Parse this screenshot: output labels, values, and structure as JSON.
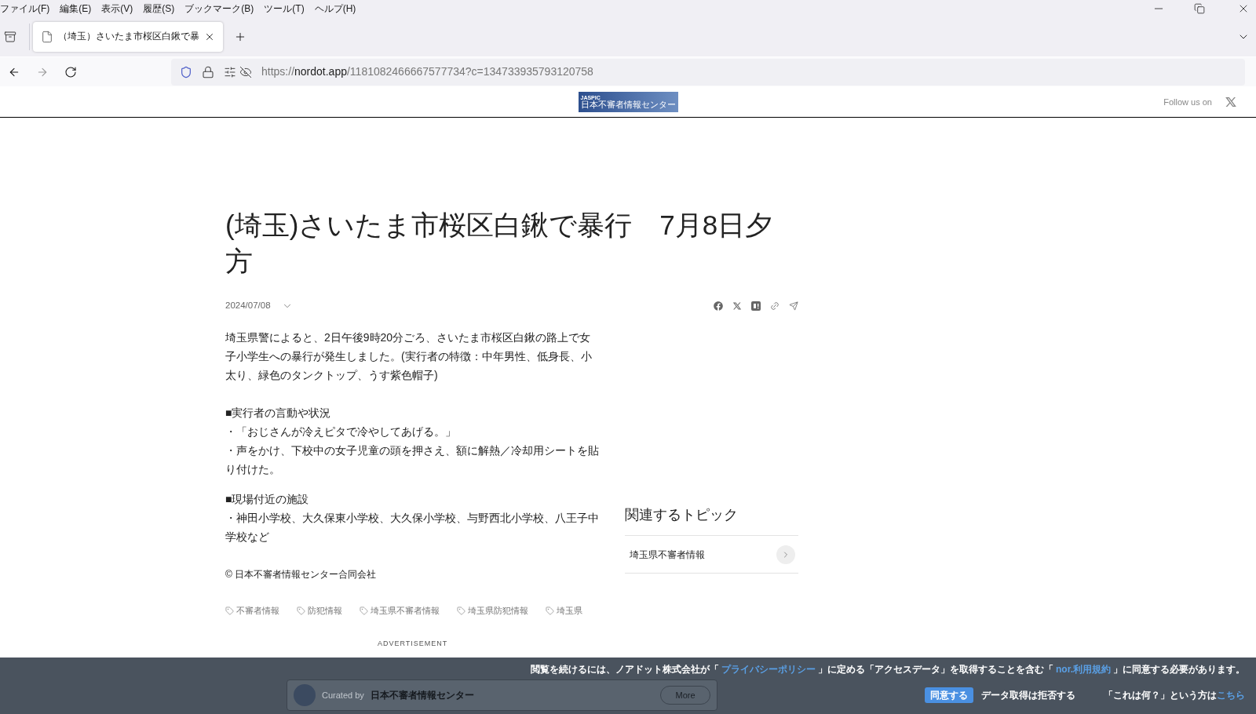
{
  "menu_bar": [
    "ファイル(F)",
    "編集(E)",
    "表示(V)",
    "履歴(S)",
    "ブックマーク(B)",
    "ツール(T)",
    "ヘルプ(H)"
  ],
  "tabs": [
    {
      "title": "（埼玉）さいたま市桜区白鍬で暴",
      "selected": true
    }
  ],
  "address_bar": {
    "url_scheme": "https://",
    "url_host": "nordot.app",
    "url_path": "/1181082466667577734?c=134733935793120758"
  },
  "site_header": {
    "logo_small": "JASPIC",
    "logo_text": "日本不審者情報センター",
    "follow_label": "Follow us on"
  },
  "article": {
    "title": "(埼玉)さいたま市桜区白鍬で暴行　7月8日夕方",
    "date": "2024/07/08",
    "blocks": [
      [
        "埼玉県警によると、2日午後9時20分ごろ、さいたま市桜区白鍬の路上で女子小学生への暴行が発生しました。(実行者の特徴：中年男性、低身長、小太り、緑色のタンクトップ、うす紫色帽子)"
      ],
      [
        "■実行者の言動や状況",
        "・「おじさんが冷えピタで冷やしてあげる。」",
        "・声をかけ、下校中の女子児童の頭を押さえ、額に解熱／冷却用シートを貼り付けた。"
      ],
      [
        "■現場付近の施設",
        "・神田小学校、大久保東小学校、大久保小学校、与野西北小学校、八王子中学校など"
      ]
    ],
    "copyright": "© 日本不審者情報センター合同会社",
    "tags": [
      "不審者情報",
      "防犯情報",
      "埼玉県不審者情報",
      "埼玉県防犯情報",
      "埼玉県"
    ],
    "ad_label": "ADVERTISEMENT"
  },
  "curator_card": {
    "prefix": "Curated by",
    "name": "日本不審者情報センター",
    "button": "More"
  },
  "related": {
    "heading": "関連するトピック",
    "items": [
      "埼玉県不審者情報"
    ]
  },
  "consent": {
    "message": [
      {
        "kind": "text",
        "text": "閲覧を続けるには、ノアドット株式会社が「"
      },
      {
        "kind": "link",
        "text": "プライバシーポリシー"
      },
      {
        "kind": "text",
        "text": "」に定める「アクセスデータ」を取得することを含む「"
      },
      {
        "kind": "link",
        "text": "nor.利用規約"
      },
      {
        "kind": "text",
        "text": "」に同意する必要があります。"
      }
    ],
    "accept": "同意する",
    "reject": "データ取得は拒否する",
    "help_prefix": "「これは何？」という方は",
    "help_link": "こちら"
  }
}
